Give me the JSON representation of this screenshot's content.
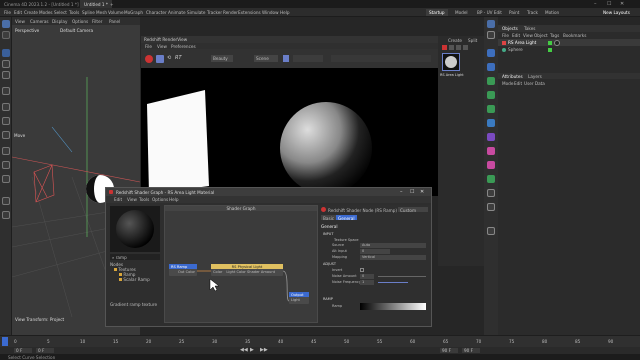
{
  "window": {
    "title": "Cinema 4D 2023.1.2 - [Untitled 1 *] - Main"
  },
  "tabs": [
    "Untitled 1 *",
    "+"
  ],
  "menu": [
    "File",
    "Edit",
    "Create",
    "Modes",
    "Select",
    "Tools",
    "Spline",
    "Mesh",
    "Volume",
    "MoGraph",
    "Character",
    "Animate",
    "Simulate",
    "Tracker",
    "Render",
    "Extensions",
    "Window",
    "Help"
  ],
  "layouts": [
    {
      "label": "Startup",
      "active": true
    },
    {
      "label": "Model",
      "active": false
    },
    {
      "label": "BP - UV Edit",
      "active": false
    },
    {
      "label": "Paint",
      "active": false
    },
    {
      "label": "Track",
      "active": false
    },
    {
      "label": "Motion",
      "active": false
    },
    {
      "label": "New Layouts",
      "active": false
    }
  ],
  "viewport": {
    "menu": [
      "View",
      "Cameras",
      "Display",
      "Options",
      "Filter",
      "Panel"
    ],
    "label_left": "Perspective",
    "label_camera": "Default Camera",
    "move_label": "Move",
    "footer": "View Transform: Project",
    "grid_spacing": "Grid Spacing : 50 cm"
  },
  "renderview": {
    "title": "Redshift RenderView",
    "menu": [
      "File",
      "View",
      "Preferences"
    ],
    "dropdown": "Beauty",
    "dropdown2": "Scene",
    "thumb_label": "RS Area Light"
  },
  "create_panel": {
    "items": [
      "Create",
      "Split"
    ]
  },
  "objects": {
    "tabs": [
      "Objects",
      "Takes"
    ],
    "menu": [
      "File",
      "Edit",
      "View",
      "Object",
      "Tags",
      "Bookmarks"
    ],
    "items": [
      {
        "name": "RS Area Light",
        "color": "#d44"
      },
      {
        "name": "Sphere",
        "color": "#4a8"
      }
    ]
  },
  "attributes": {
    "tabs": [
      "Attributes",
      "Layers"
    ],
    "menu": [
      "Mode",
      "Edit",
      "User Data"
    ]
  },
  "shader_graph": {
    "title": "Redshift Shader Graph - RS Area Light Material",
    "menu": [
      "Edit",
      "View",
      "Tools",
      "Options",
      "Help"
    ],
    "canvas_title": "Shader Graph",
    "search_placeholder": "ramp",
    "tree": {
      "root": "Nodes",
      "folder": "Textures",
      "items": [
        "Ramp",
        "Scalar Ramp"
      ],
      "desc": "Gradient ramp texture"
    },
    "nodes": {
      "ramp": {
        "title": "RS Ramp",
        "out": "Out Color"
      },
      "physical": {
        "title": "RS Physical Light",
        "in1": "Color",
        "in2": "Light Color Shader Amount"
      },
      "output": {
        "title": "Output",
        "port": "Light"
      }
    },
    "props": {
      "header": "Redshift Shader Node (RS Ramp)",
      "preset": "Custom",
      "tabs": [
        "Basic",
        "General"
      ],
      "section": "General",
      "input_group": "INPUT",
      "texture_space": "Texture Space",
      "rows": [
        {
          "label": "Source",
          "value": "Auto"
        },
        {
          "label": "Alt Input",
          "value": "0"
        },
        {
          "label": "Mapping",
          "value": "Vertical"
        }
      ],
      "adjust_group": "ADJUST",
      "adjust_rows": [
        {
          "label": "Invert",
          "value": ""
        },
        {
          "label": "Noise Amount",
          "value": "0"
        },
        {
          "label": "Noise Frequency",
          "value": "1"
        }
      ],
      "ramp_group": "RAMP",
      "ramp_label": "Ramp"
    }
  },
  "timeline": {
    "ticks": [
      "0",
      "5",
      "10",
      "15",
      "20",
      "25",
      "30",
      "35",
      "40",
      "45",
      "50",
      "55",
      "60",
      "65",
      "70",
      "75",
      "80",
      "85",
      "90"
    ],
    "start": "0 F",
    "frame": "0 F",
    "end": "90 F",
    "end2": "90 F"
  },
  "status": {
    "text": "Select Curve Selection"
  }
}
